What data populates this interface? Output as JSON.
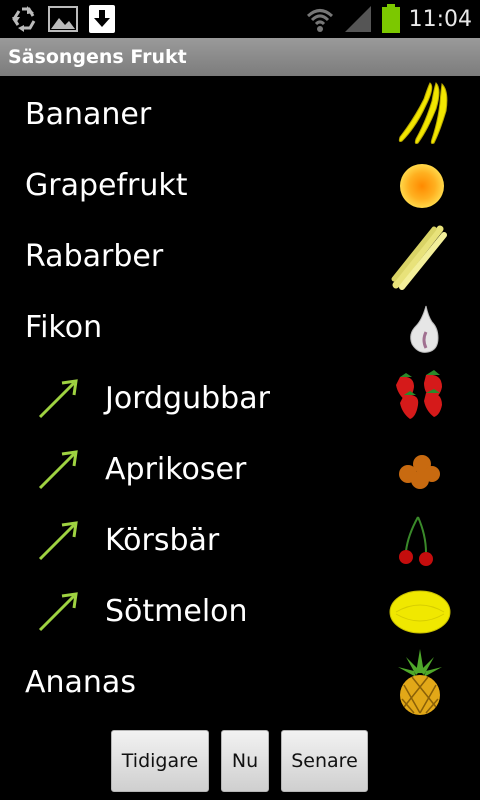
{
  "status_bar": {
    "time": "11:04",
    "icons": [
      "recycle-icon",
      "gallery-icon",
      "download-icon",
      "wifi-icon",
      "signal-icon",
      "battery-icon"
    ],
    "battery_color": "#7cc800"
  },
  "app": {
    "title": "Säsongens Frukt"
  },
  "fruits": [
    {
      "label": "Bananer",
      "icon": "banana-icon",
      "indented": false
    },
    {
      "label": "Grapefrukt",
      "icon": "grapefruit-icon",
      "indented": false
    },
    {
      "label": "Rabarber",
      "icon": "rhubarb-icon",
      "indented": false
    },
    {
      "label": "Fikon",
      "icon": "fig-icon",
      "indented": false
    },
    {
      "label": "Jordgubbar",
      "icon": "strawberry-icon",
      "indented": true
    },
    {
      "label": "Aprikoser",
      "icon": "apricot-icon",
      "indented": true
    },
    {
      "label": "Körsbär",
      "icon": "cherry-icon",
      "indented": true
    },
    {
      "label": "Sötmelon",
      "icon": "melon-icon",
      "indented": true
    },
    {
      "label": "Ananas",
      "icon": "pineapple-icon",
      "indented": false
    }
  ],
  "buttons": {
    "earlier": "Tidigare",
    "now": "Nu",
    "later": "Senare"
  },
  "colors": {
    "arrow": "#9fd341",
    "titlebar": "#888888"
  }
}
